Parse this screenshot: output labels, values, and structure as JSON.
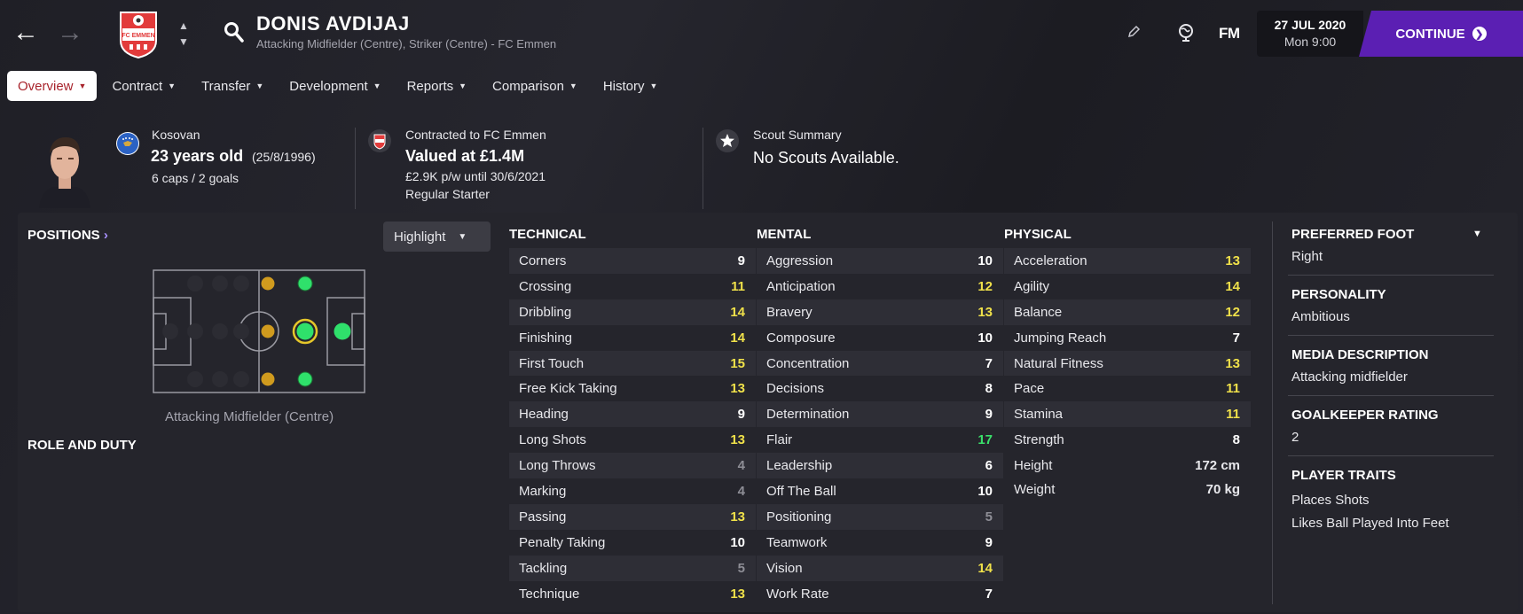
{
  "header": {
    "player_name": "DONIS AVDIJAJ",
    "subtitle": "Attacking Midfielder (Centre), Striker (Centre) - FC Emmen",
    "fm_label": "FM",
    "date": "27 JUL 2020",
    "time": "Mon 9:00",
    "continue_label": "CONTINUE",
    "crest_text": "FC EMMEN"
  },
  "tabs": [
    {
      "label": "Overview"
    },
    {
      "label": "Contract"
    },
    {
      "label": "Transfer"
    },
    {
      "label": "Development"
    },
    {
      "label": "Reports"
    },
    {
      "label": "Comparison"
    },
    {
      "label": "History"
    }
  ],
  "info": {
    "nationality": "Kosovan",
    "age": "23 years old",
    "dob": "(25/8/1996)",
    "caps": "6 caps / 2 goals",
    "contracted": "Contracted to FC Emmen",
    "value": "Valued at £1.4M",
    "wage": "£2.9K p/w until 30/6/2021",
    "status": "Regular Starter",
    "scout_title": "Scout Summary",
    "scout_value": "No Scouts Available."
  },
  "positions": {
    "heading": "POSITIONS",
    "highlight_label": "Highlight",
    "label": "Attacking Midfielder (Centre)",
    "role_heading": "ROLE AND DUTY"
  },
  "technical": {
    "heading": "TECHNICAL",
    "rows": [
      {
        "name": "Corners",
        "value": "9"
      },
      {
        "name": "Crossing",
        "value": "11"
      },
      {
        "name": "Dribbling",
        "value": "14"
      },
      {
        "name": "Finishing",
        "value": "14"
      },
      {
        "name": "First Touch",
        "value": "15"
      },
      {
        "name": "Free Kick Taking",
        "value": "13"
      },
      {
        "name": "Heading",
        "value": "9"
      },
      {
        "name": "Long Shots",
        "value": "13"
      },
      {
        "name": "Long Throws",
        "value": "4"
      },
      {
        "name": "Marking",
        "value": "4"
      },
      {
        "name": "Passing",
        "value": "13"
      },
      {
        "name": "Penalty Taking",
        "value": "10"
      },
      {
        "name": "Tackling",
        "value": "5"
      },
      {
        "name": "Technique",
        "value": "13"
      }
    ]
  },
  "mental": {
    "heading": "MENTAL",
    "rows": [
      {
        "name": "Aggression",
        "value": "10"
      },
      {
        "name": "Anticipation",
        "value": "12"
      },
      {
        "name": "Bravery",
        "value": "13"
      },
      {
        "name": "Composure",
        "value": "10"
      },
      {
        "name": "Concentration",
        "value": "7"
      },
      {
        "name": "Decisions",
        "value": "8"
      },
      {
        "name": "Determination",
        "value": "9"
      },
      {
        "name": "Flair",
        "value": "17"
      },
      {
        "name": "Leadership",
        "value": "6"
      },
      {
        "name": "Off The Ball",
        "value": "10"
      },
      {
        "name": "Positioning",
        "value": "5"
      },
      {
        "name": "Teamwork",
        "value": "9"
      },
      {
        "name": "Vision",
        "value": "14"
      },
      {
        "name": "Work Rate",
        "value": "7"
      }
    ]
  },
  "physical": {
    "heading": "PHYSICAL",
    "rows": [
      {
        "name": "Acceleration",
        "value": "13"
      },
      {
        "name": "Agility",
        "value": "14"
      },
      {
        "name": "Balance",
        "value": "12"
      },
      {
        "name": "Jumping Reach",
        "value": "7"
      },
      {
        "name": "Natural Fitness",
        "value": "13"
      },
      {
        "name": "Pace",
        "value": "11"
      },
      {
        "name": "Stamina",
        "value": "11"
      },
      {
        "name": "Strength",
        "value": "8"
      }
    ],
    "height_label": "Height",
    "height_value": "172 cm",
    "weight_label": "Weight",
    "weight_value": "70 kg"
  },
  "side": {
    "foot_heading": "PREFERRED FOOT",
    "foot_value": "Right",
    "personality_heading": "PERSONALITY",
    "personality_value": "Ambitious",
    "media_heading": "MEDIA DESCRIPTION",
    "media_value": "Attacking midfielder",
    "gk_heading": "GOALKEEPER RATING",
    "gk_value": "2",
    "traits_heading": "PLAYER TRAITS",
    "traits": [
      "Places Shots",
      "Likes Ball Played Into Feet"
    ]
  },
  "colors": {
    "accent_purple": "#5b1fb3",
    "attr_gray": "#8e8e96",
    "attr_white": "#ffffff",
    "attr_yellow": "#f0e14a",
    "attr_green": "#3ae06a",
    "pos_natural": "#2fe06b",
    "pos_partial": "#d09b1e"
  }
}
